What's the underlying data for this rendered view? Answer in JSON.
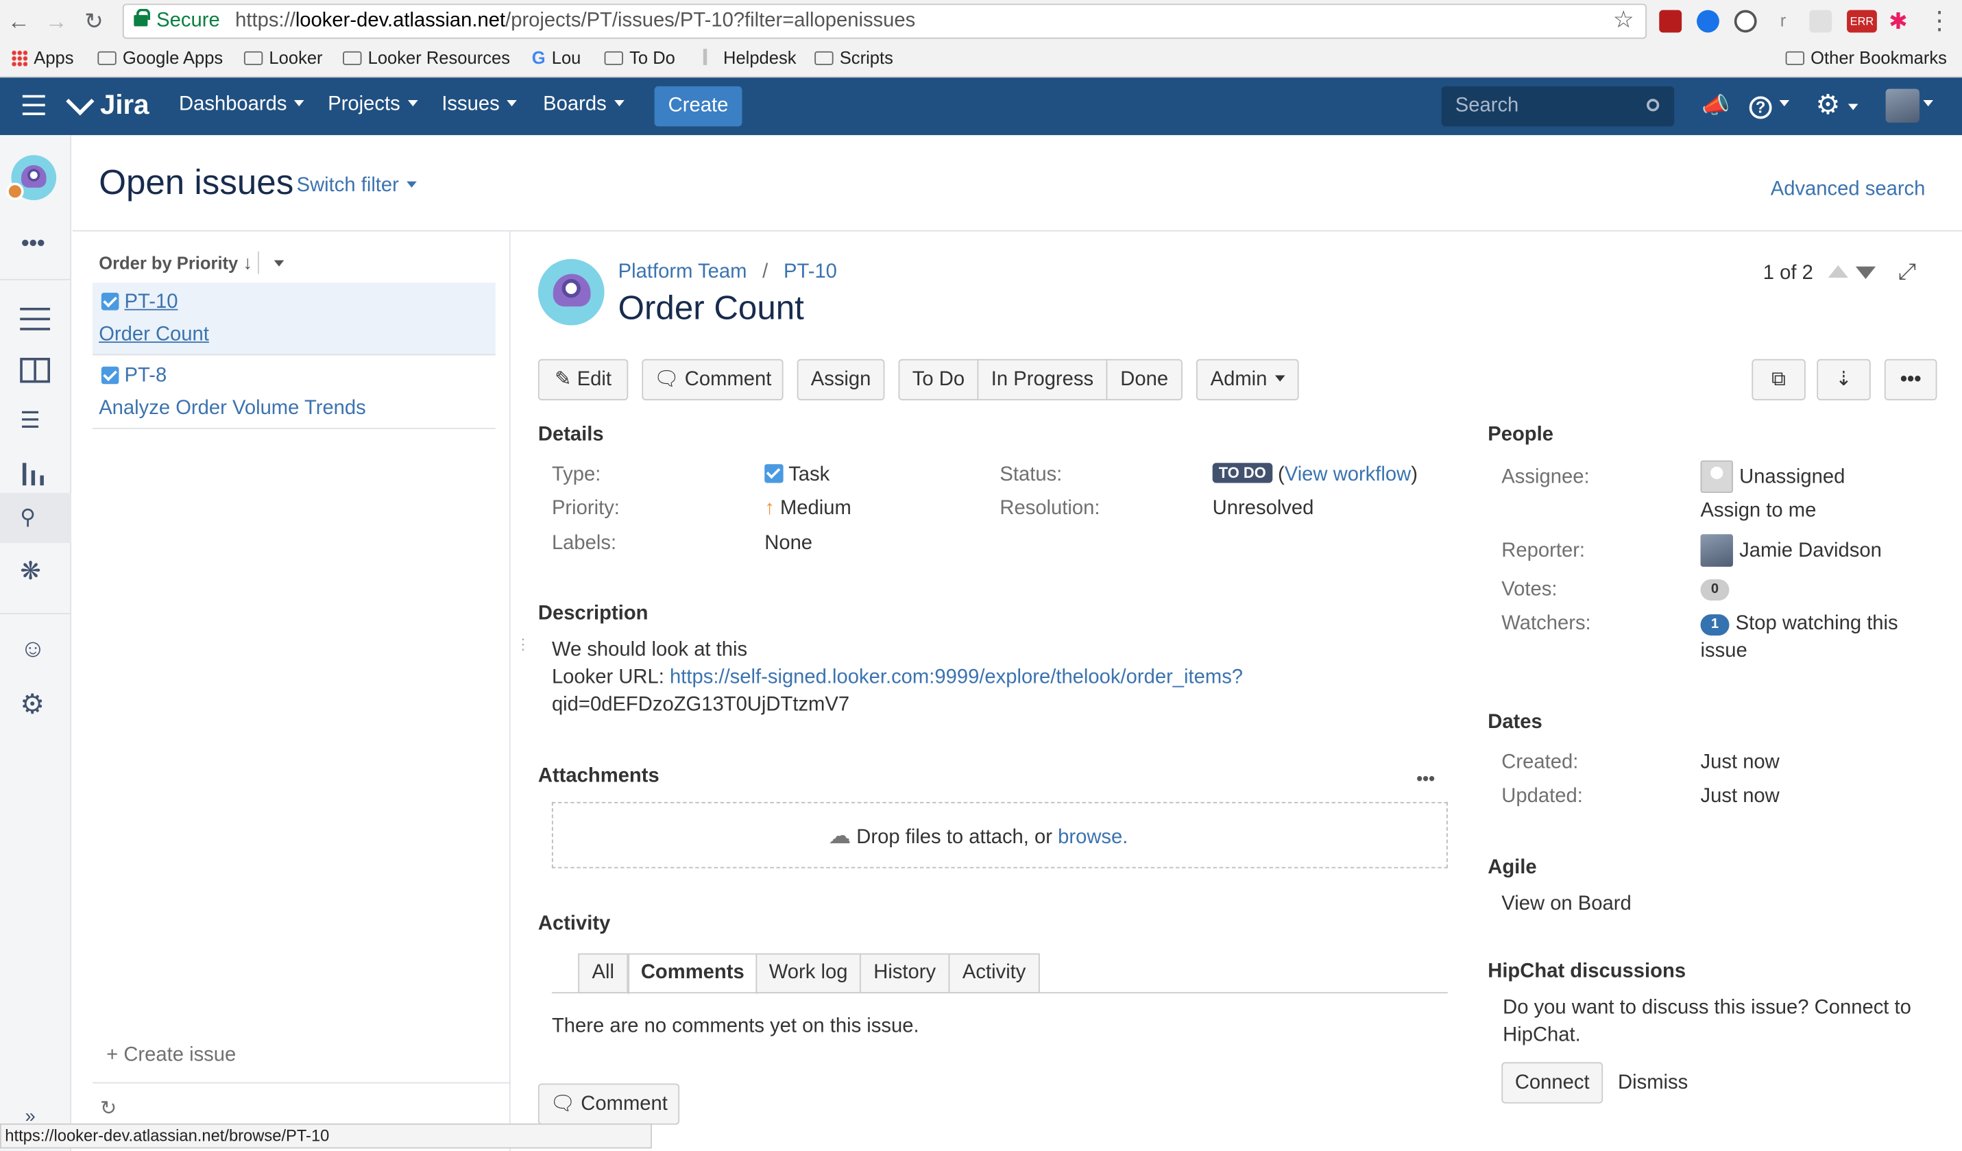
{
  "browser": {
    "secure_label": "Secure",
    "url_prefix": "https://",
    "url_host": "looker-dev.atlassian.net",
    "url_path": "/projects/PT/issues/PT-10?filter=allopenissues",
    "bookmarks": [
      "Apps",
      "Google Apps",
      "Looker",
      "Looker Resources",
      "Lou",
      "To Do",
      "Helpdesk",
      "Scripts"
    ],
    "other_bookmarks": "Other Bookmarks",
    "status_url": "https://looker-dev.atlassian.net/browse/PT-10",
    "ext_badge": "ERR",
    "ext_letter": "r"
  },
  "header": {
    "logo": "Jira",
    "nav": [
      "Dashboards",
      "Projects",
      "Issues",
      "Boards"
    ],
    "create": "Create",
    "search_placeholder": "Search"
  },
  "page": {
    "title": "Open issues",
    "switch_filter": "Switch filter",
    "advanced_search": "Advanced search"
  },
  "list": {
    "order_label": "Order by Priority",
    "items": [
      {
        "key": "PT-10",
        "summary": "Order Count"
      },
      {
        "key": "PT-8",
        "summary": "Analyze Order Volume Trends"
      }
    ],
    "create_issue": "+ Create issue"
  },
  "issue": {
    "project": "Platform Team",
    "separator": "/",
    "key": "PT-10",
    "summary": "Order Count",
    "pager": "1 of 2",
    "buttons": {
      "edit": "Edit",
      "comment": "Comment",
      "assign": "Assign",
      "todo": "To Do",
      "in_progress": "In Progress",
      "done": "Done",
      "admin": "Admin"
    },
    "details": {
      "heading": "Details",
      "type_label": "Type:",
      "type": "Task",
      "priority_label": "Priority:",
      "priority": "Medium",
      "labels_label": "Labels:",
      "labels": "None",
      "status_label": "Status:",
      "status": "TO DO",
      "view_workflow": "View workflow",
      "resolution_label": "Resolution:",
      "resolution": "Unresolved"
    },
    "description": {
      "heading": "Description",
      "line1": "We should look at this",
      "url_label": "Looker URL:",
      "url_line1": "https://self-signed.looker.com:9999/explore/thelook/order_items?",
      "url_line2": "qid=0dEFDzoZG13T0UjDTtzmV7"
    },
    "attachments": {
      "heading": "Attachments",
      "drop_text": "Drop files to attach, or",
      "browse": "browse."
    },
    "activity": {
      "heading": "Activity",
      "tabs": [
        "All",
        "Comments",
        "Work log",
        "History",
        "Activity"
      ],
      "active_tab": "Comments",
      "empty": "There are no comments yet on this issue.",
      "comment_button": "Comment"
    }
  },
  "people": {
    "heading": "People",
    "assignee_label": "Assignee:",
    "assignee": "Unassigned",
    "assign_to_me": "Assign to me",
    "reporter_label": "Reporter:",
    "reporter": "Jamie Davidson",
    "votes_label": "Votes:",
    "votes": "0",
    "watchers_label": "Watchers:",
    "watchers_count": "1",
    "stop_watching_1": "Stop watching this",
    "stop_watching_2": "issue"
  },
  "dates": {
    "heading": "Dates",
    "created_label": "Created:",
    "created": "Just now",
    "updated_label": "Updated:",
    "updated": "Just now"
  },
  "agile": {
    "heading": "Agile",
    "view_on_board": "View on Board"
  },
  "hipchat": {
    "heading": "HipChat discussions",
    "text_1": "Do you want to discuss this issue? Connect to",
    "text_2": "HipChat.",
    "connect": "Connect",
    "dismiss": "Dismiss"
  },
  "colors": {
    "header_bg": "#205081",
    "create_bg": "#3b7fc4",
    "link": "#3b73af",
    "status_badge": "#42526e",
    "priority_medium": "#f79232"
  }
}
